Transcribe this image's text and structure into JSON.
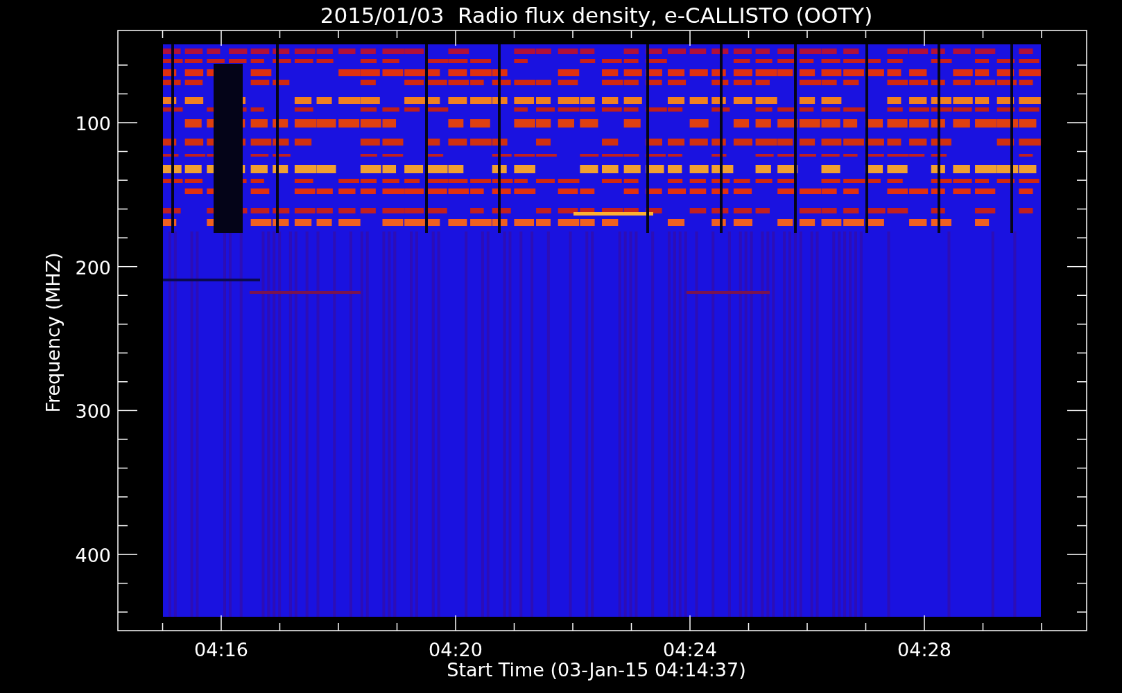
{
  "title": "2015/01/03  Radio flux density, e-CALLISTO (OOTY)",
  "y_axis": {
    "label": "Frequency (MHZ)",
    "ticks": [
      "100",
      "200",
      "300",
      "400"
    ]
  },
  "x_axis": {
    "label": "Start Time (03-Jan-15 04:14:37)",
    "ticks": [
      "04:16",
      "04:20",
      "04:24",
      "04:28"
    ]
  }
}
